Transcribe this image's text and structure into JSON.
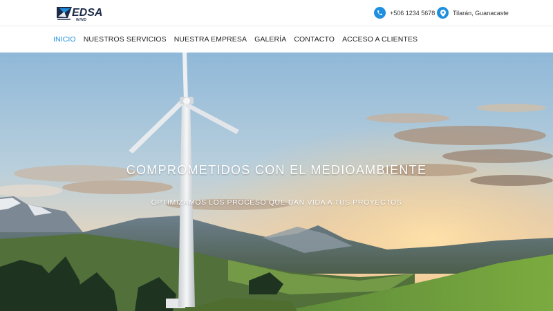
{
  "header": {
    "logo": {
      "text": "EDSA",
      "subtext": "WIND"
    },
    "phone": {
      "icon": "phone-icon",
      "text": "+506 1234 5678"
    },
    "location": {
      "icon": "map-pin-icon",
      "text": "Tilarán, Guanacaste"
    }
  },
  "nav": {
    "items": [
      {
        "label": "INICIO",
        "active": true
      },
      {
        "label": "NUESTROS SERVICIOS",
        "active": false
      },
      {
        "label": "NUESTRA EMPRESA",
        "active": false
      },
      {
        "label": "GALERÍA",
        "active": false
      },
      {
        "label": "CONTACTO",
        "active": false
      },
      {
        "label": "ACCESO A CLIENTES",
        "active": false
      }
    ]
  },
  "hero": {
    "title": "COMPROMETIDOS CON EL MEDIOAMBIENTE",
    "subtitle": "OPTIMIZAMOS LOS PROCESO QUE DAN VIDA A TUS PROYECTOS"
  },
  "colors": {
    "accent": "#1f8fe0",
    "logo_dark": "#1c2b4a"
  }
}
